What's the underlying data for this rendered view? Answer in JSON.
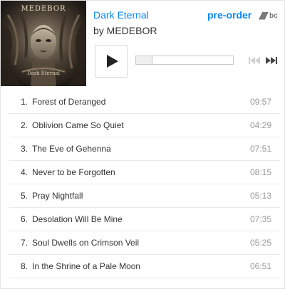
{
  "album": {
    "title": "Dark Eternal",
    "artist_line": "by MEDEBOR",
    "cover_band_text": "MEDEBOR",
    "cover_album_text": "Dark Eternal"
  },
  "actions": {
    "preorder_label": "pre-order",
    "logo_text": "bc"
  },
  "player": {
    "progress": 0
  },
  "tracks": [
    {
      "num": "1",
      "name": "Forest of Deranged",
      "duration": "09:57"
    },
    {
      "num": "2",
      "name": "Oblivion Came So Quiet",
      "duration": "04:29"
    },
    {
      "num": "3",
      "name": "The Eve of Gehenna",
      "duration": "07:51"
    },
    {
      "num": "4",
      "name": "Never to be Forgotten",
      "duration": "08:15"
    },
    {
      "num": "5",
      "name": "Pray Nightfall",
      "duration": "05:13"
    },
    {
      "num": "6",
      "name": "Desolation Will Be Mine",
      "duration": "07:35"
    },
    {
      "num": "7",
      "name": "Soul Dwells on Crimson Veil",
      "duration": "05:25"
    },
    {
      "num": "8",
      "name": "In the Shrine of a Pale Moon",
      "duration": "06:51"
    }
  ]
}
